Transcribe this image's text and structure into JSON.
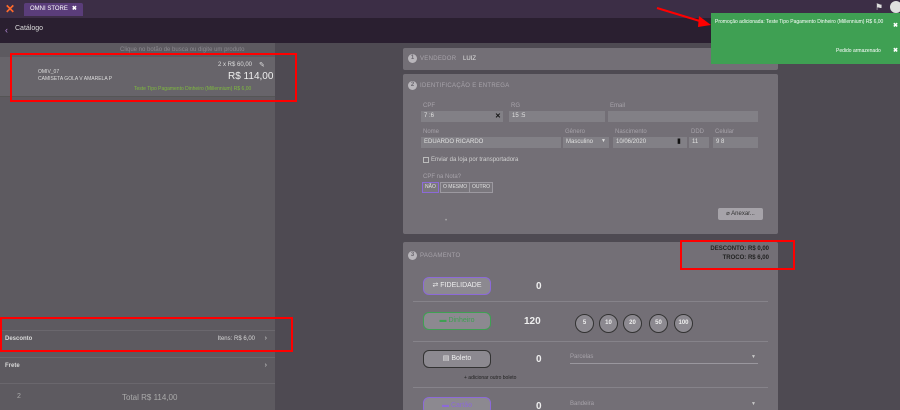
{
  "app": {
    "tab_label": "OMNI STORE",
    "tab_close": "✖",
    "logo_icon": "omni-store-logo-icon",
    "nav_title": "Catálogo"
  },
  "cart": {
    "hint": "Clique no botão de busca ou digite um produto",
    "items": [
      {
        "code": "OMIV_07",
        "name": "CAMISETA GOLA V AMARELA P",
        "qty": "2 x R$ 60,00",
        "price": "R$ 114,00",
        "promo": "Teste Tipo Pagamento Dinheiro (Millennium) R$ 6,00"
      }
    ],
    "desconto_label": "Desconto",
    "desconto_value": "Itens: R$ 6,00",
    "frete_label": "Frete",
    "total_count": "2",
    "total_label": "Total R$ 114,00"
  },
  "vendedor": {
    "num": "1",
    "title": "VENDEDOR",
    "name": "LUIZ"
  },
  "identificacao": {
    "num": "2",
    "title": "IDENTIFICAÇÃO E ENTREGA",
    "cpf_label": "CPF",
    "cpf_value": "7          :6",
    "rg_label": "RG",
    "rg_value": "15     :5",
    "email_label": "Email",
    "email_value": "",
    "nome_label": "Nome",
    "nome_value": "EDUARDO RICARDO",
    "genero_label": "Gênero",
    "genero_value": "Masculino",
    "nascimento_label": "Nascimento",
    "nascimento_value": "10/06/2020",
    "ddd_label": "DDD",
    "ddd_value": "11",
    "celular_label": "Celular",
    "celular_value": "9       8",
    "enviar_label": "Enviar da loja por transportadora",
    "cpf_nota_label": "CPF na Nota?",
    "cpf_nota_options": [
      "NÃO",
      "O MESMO",
      "OUTRO"
    ],
    "anexar_label": "Anexar...",
    "small_dot": "•"
  },
  "pagamento": {
    "num": "3",
    "title": "PAGAMENTO",
    "desconto": "DESCONTO: R$ 0,00",
    "troco": "TROCO: R$ 6,00",
    "fidelidade_label": "FIDELIDADE",
    "fidelidade_value": "0",
    "dinheiro_label": "Dinheiro",
    "dinheiro_value": "120",
    "coins": [
      "5",
      "10",
      "20",
      "50",
      "100"
    ],
    "boleto_label": "Boleto",
    "boleto_value": "0",
    "parcelas_label": "Parcelas",
    "add_boleto": "+ adicionar outro boleto",
    "cartao_label": "Cartão",
    "cartao_value": "0",
    "bandeira_label": "Bandeira",
    "accent_color": "#8c6ad8",
    "dinheiro_color": "#3fa053"
  },
  "toasts": [
    {
      "text": "Promoção adicionada: Teste Tipo Pagamento Dinheiro (Millennium) R$ 6,00",
      "close": "✖"
    },
    {
      "text": "Pedido armazenado",
      "close": "✖"
    }
  ]
}
